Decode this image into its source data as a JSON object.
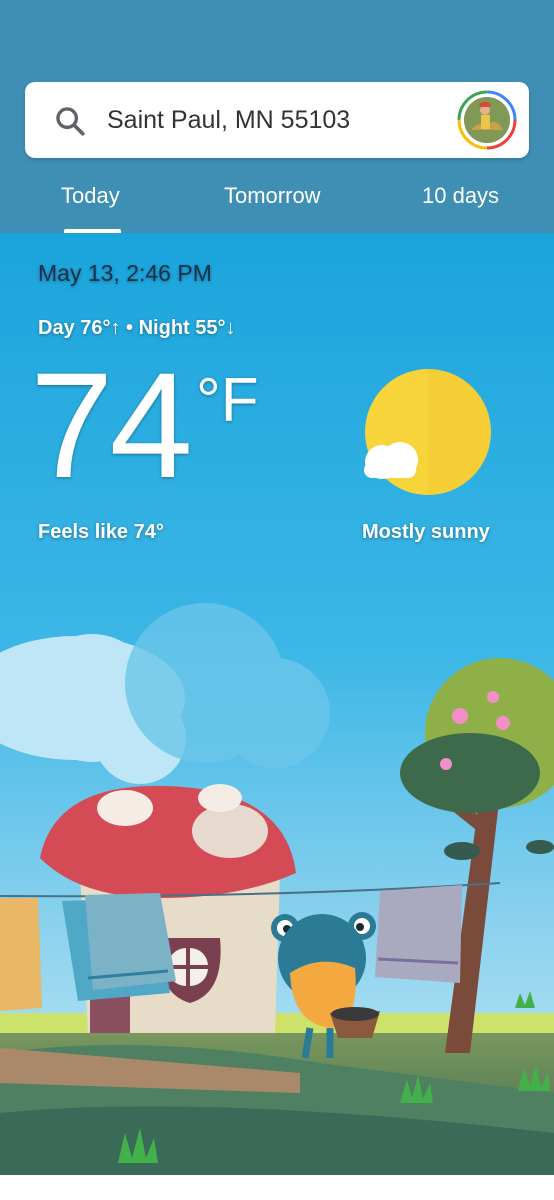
{
  "search": {
    "location": "Saint Paul, MN 55103"
  },
  "tabs": [
    {
      "label": "Today",
      "selected": true
    },
    {
      "label": "Tomorrow",
      "selected": false
    },
    {
      "label": "10 days",
      "selected": false
    }
  ],
  "weather": {
    "datetime": "May 13, 2:46 PM",
    "day_night": "Day 76°↑ • Night 55°↓",
    "temperature": "74",
    "unit": "°F",
    "feels_like": "Feels like 74°",
    "condition": "Mostly sunny",
    "condition_icon": "sun-with-cloud-icon"
  },
  "colors": {
    "header_bg": "#3f8fb5",
    "sky_top": "#1ea6dc",
    "sun": "#f7d43a"
  }
}
